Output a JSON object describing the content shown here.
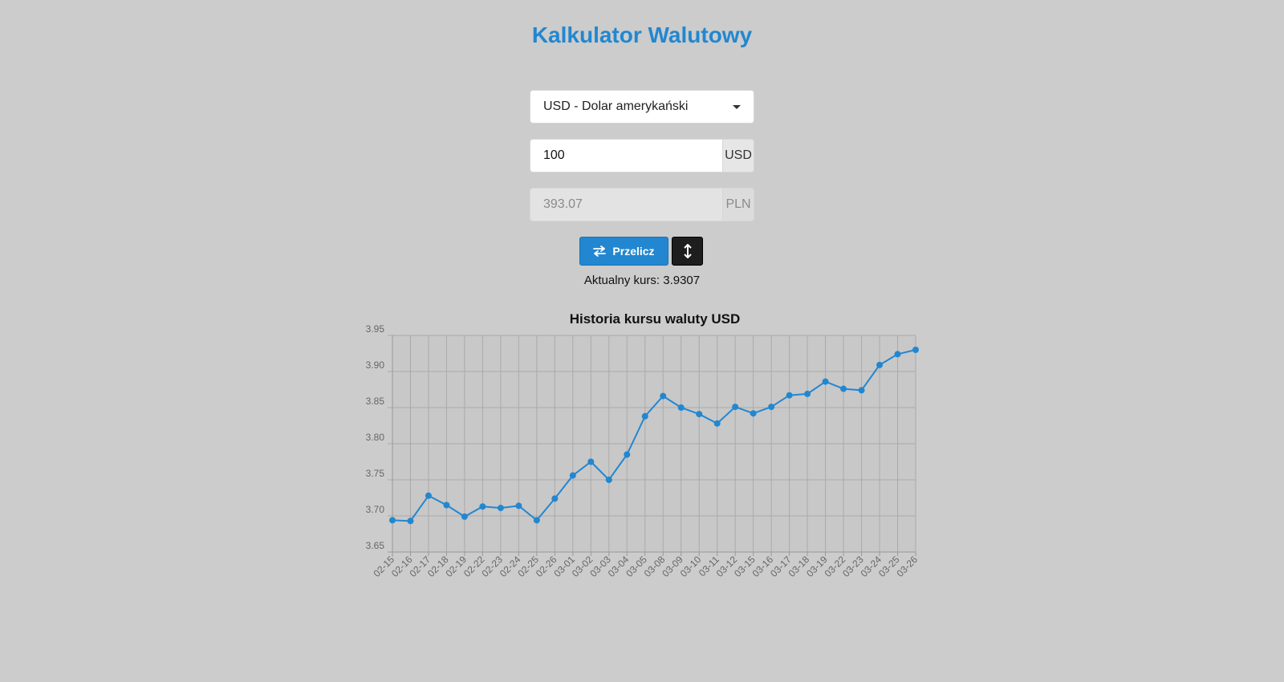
{
  "header": {
    "title": "Kalkulator Walutowy"
  },
  "form": {
    "currency_select": "USD - Dolar amerykański",
    "amount_value": "100",
    "amount_currency": "USD",
    "result_value": "393.07",
    "result_currency": "PLN",
    "convert_label": "Przelicz",
    "rate_text": "Aktualny kurs: 3.9307"
  },
  "colors": {
    "accent": "#2287d0",
    "background": "#cccccc",
    "swap_button": "#1e1e1e"
  },
  "icons": {
    "convert": "arrows-exchange-icon",
    "swap": "vertical-arrows-icon",
    "select": "caret-down-icon"
  },
  "chart_data": {
    "type": "line",
    "title": "Historia kursu waluty USD",
    "xlabel": "",
    "ylabel": "",
    "ylim": [
      3.65,
      3.95
    ],
    "yticks": [
      "3.65",
      "3.70",
      "3.75",
      "3.80",
      "3.85",
      "3.90",
      "3.95"
    ],
    "grid": true,
    "x": [
      "02-15",
      "02-16",
      "02-17",
      "02-18",
      "02-19",
      "02-22",
      "02-23",
      "02-24",
      "02-25",
      "02-26",
      "03-01",
      "03-02",
      "03-03",
      "03-04",
      "03-05",
      "03-08",
      "03-09",
      "03-10",
      "03-11",
      "03-12",
      "03-15",
      "03-16",
      "03-17",
      "03-18",
      "03-19",
      "03-22",
      "03-23",
      "03-24",
      "03-25",
      "03-26"
    ],
    "series": [
      {
        "color": "#2287d0",
        "values": [
          3.694,
          3.693,
          3.728,
          3.715,
          3.699,
          3.713,
          3.711,
          3.714,
          3.694,
          3.724,
          3.756,
          3.775,
          3.75,
          3.785,
          3.838,
          3.866,
          3.85,
          3.841,
          3.828,
          3.851,
          3.842,
          3.851,
          3.867,
          3.869,
          3.886,
          3.876,
          3.874,
          3.909,
          3.924,
          3.93
        ]
      }
    ]
  }
}
